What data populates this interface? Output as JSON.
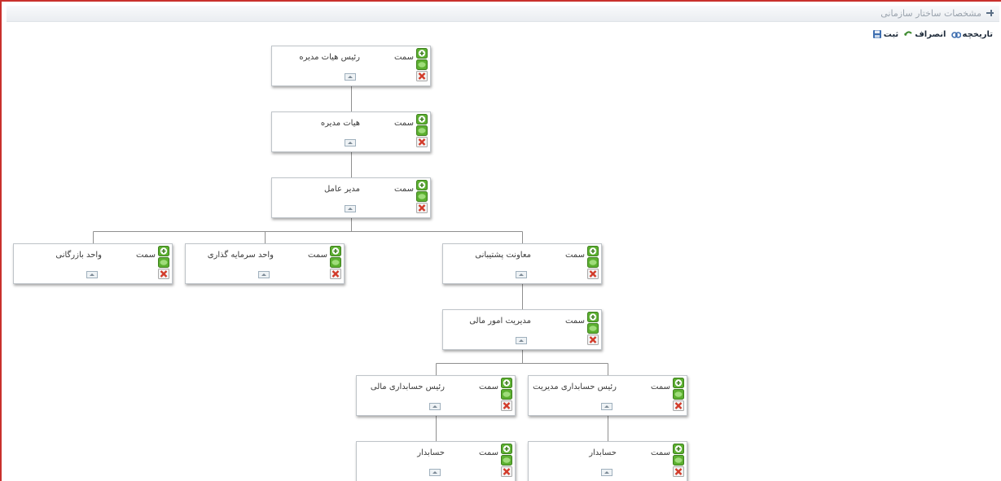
{
  "panel": {
    "title": "مشخصات ساختار سازمانی"
  },
  "toolbar": {
    "save_label": "ثبت",
    "cancel_label": "انصراف",
    "history_label": "تاریخچه"
  },
  "node_field_label": "سمت",
  "nodes": [
    {
      "id": "n1",
      "position": "رئیس هیات مدیره"
    },
    {
      "id": "n2",
      "position": "هیات مدیره"
    },
    {
      "id": "n3",
      "position": "مدیر عامل"
    },
    {
      "id": "n4",
      "position": "واحد بازرگانی"
    },
    {
      "id": "n5",
      "position": "واحد سرمایه گذاری"
    },
    {
      "id": "n6",
      "position": "معاونت پشتیبانی"
    },
    {
      "id": "n7",
      "position": "مدیریت امور مالی"
    },
    {
      "id": "n8",
      "position": "رئیس حسابداری مالی"
    },
    {
      "id": "n9",
      "position": "رئیس حسابداری مدیریت"
    },
    {
      "id": "n10",
      "position": "حسابدار"
    },
    {
      "id": "n11",
      "position": "حسابدار"
    }
  ],
  "edges": [
    [
      "n1",
      "n2"
    ],
    [
      "n2",
      "n3"
    ],
    [
      "n3",
      "n4"
    ],
    [
      "n3",
      "n5"
    ],
    [
      "n3",
      "n6"
    ],
    [
      "n6",
      "n7"
    ],
    [
      "n7",
      "n8"
    ],
    [
      "n7",
      "n9"
    ],
    [
      "n8",
      "n10"
    ],
    [
      "n9",
      "n11"
    ]
  ],
  "icons": {
    "add": "add-icon",
    "edit": "edit-icon",
    "delete": "delete-icon",
    "collapse": "collapse-icon",
    "save": "save-icon",
    "cancel": "cancel-icon",
    "history": "history-icon",
    "pin": "pin-icon"
  },
  "colors": {
    "frame_border": "#c9302c",
    "add_green": "#5cb030",
    "delete_red": "#d23b2a",
    "connector": "#8f8f8f"
  }
}
